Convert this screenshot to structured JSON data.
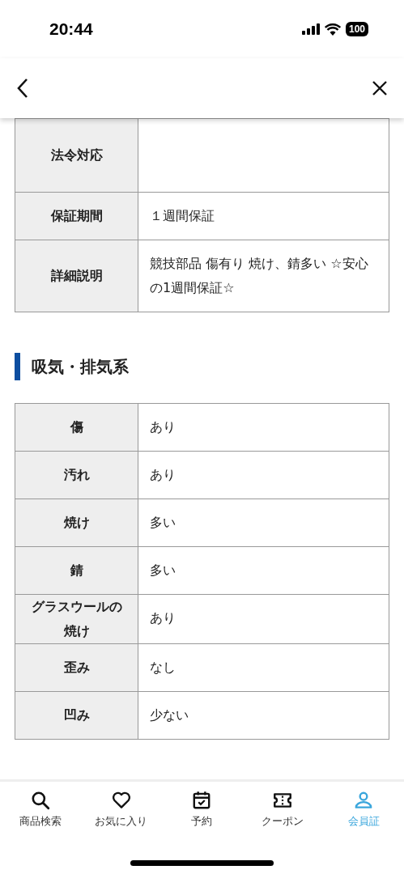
{
  "status_bar": {
    "time": "20:44",
    "battery": "100"
  },
  "spec_table": {
    "rows": [
      {
        "label": "法令対応"
      },
      {
        "label": "保証期間",
        "value": "１週間保証"
      },
      {
        "label": "詳細説明",
        "value": "競技部品 傷有り 焼け、錆多い ☆安心の1週間保証☆"
      }
    ]
  },
  "section": {
    "title": "吸気・排気系",
    "rows": [
      {
        "label": "傷",
        "value": "あり"
      },
      {
        "label": "汚れ",
        "value": "あり"
      },
      {
        "label": "焼け",
        "value": "多い"
      },
      {
        "label": "錆",
        "value": "多い"
      },
      {
        "label": "グラスウールの焼け",
        "value": "あり"
      },
      {
        "label": "歪み",
        "value": "なし"
      },
      {
        "label": "凹み",
        "value": "少ない"
      }
    ]
  },
  "tab_bar": [
    {
      "label": "商品検索",
      "selected": false
    },
    {
      "label": "お気に入り",
      "selected": false
    },
    {
      "label": "予約",
      "selected": false
    },
    {
      "label": "クーポン",
      "selected": false
    },
    {
      "label": "会員証",
      "selected": true
    }
  ]
}
